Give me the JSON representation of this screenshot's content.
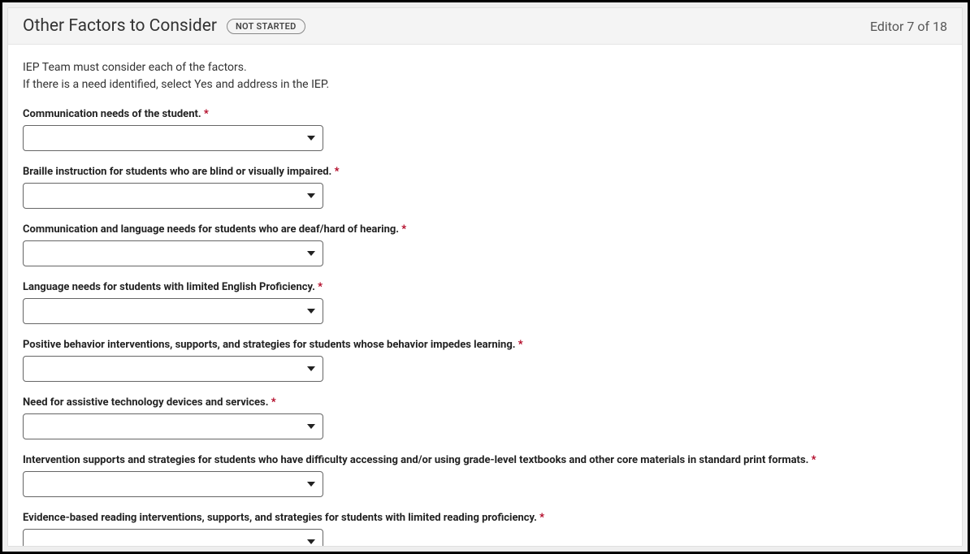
{
  "header": {
    "title": "Other Factors to Consider",
    "status": "NOT STARTED",
    "editor_count": "Editor 7 of 18"
  },
  "intro": {
    "line1": "IEP Team must consider each of the factors.",
    "line2": "If there is a need identified, select Yes and address in the IEP."
  },
  "required_mark": "*",
  "fields": [
    {
      "label": "Communication needs of the student."
    },
    {
      "label": "Braille instruction for students who are blind or visually impaired."
    },
    {
      "label": "Communication and language needs for students who are deaf/hard of hearing."
    },
    {
      "label": "Language needs for students with limited English Proficiency."
    },
    {
      "label": "Positive behavior interventions, supports, and strategies for students whose behavior impedes learning."
    },
    {
      "label": "Need for assistive technology devices and services."
    },
    {
      "label": "Intervention supports and strategies for students who have difficulty accessing and/or using grade-level textbooks and other core materials in standard print formats."
    },
    {
      "label": "Evidence-based reading interventions, supports, and strategies for students with limited reading proficiency."
    }
  ]
}
